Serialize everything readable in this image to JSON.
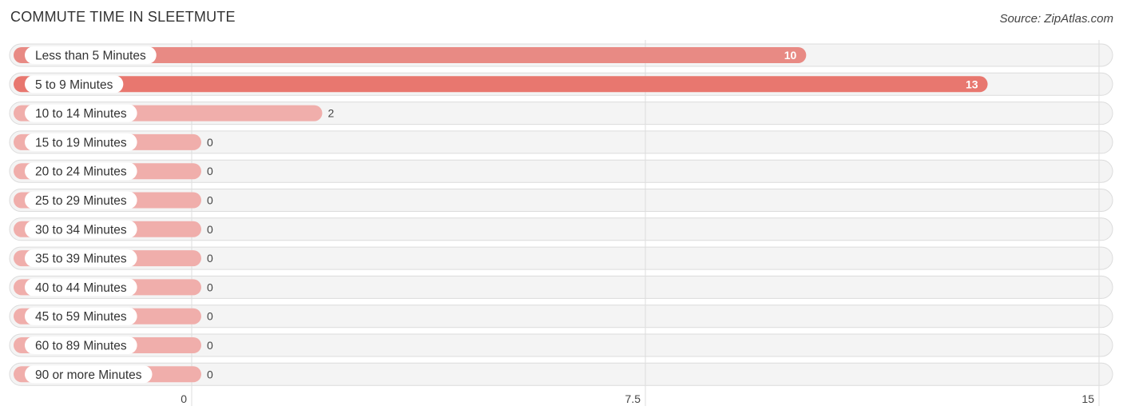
{
  "header": {
    "title": "COMMUTE TIME IN SLEETMUTE",
    "source": "Source: ZipAtlas.com"
  },
  "chart_data": {
    "type": "bar",
    "orientation": "horizontal",
    "title": "COMMUTE TIME IN SLEETMUTE",
    "xlabel": "",
    "ylabel": "",
    "categories": [
      "Less than 5 Minutes",
      "5 to 9 Minutes",
      "10 to 14 Minutes",
      "15 to 19 Minutes",
      "20 to 24 Minutes",
      "25 to 29 Minutes",
      "30 to 34 Minutes",
      "35 to 39 Minutes",
      "40 to 44 Minutes",
      "45 to 59 Minutes",
      "60 to 89 Minutes",
      "90 or more Minutes"
    ],
    "values": [
      10,
      13,
      2,
      0,
      0,
      0,
      0,
      0,
      0,
      0,
      0,
      0
    ],
    "value_labels": [
      "10",
      "13",
      "2",
      "0",
      "0",
      "0",
      "0",
      "0",
      "0",
      "0",
      "0",
      "0"
    ],
    "xlim": [
      0,
      15
    ],
    "ticks": [
      0,
      7.5,
      15
    ],
    "tick_labels": [
      "0",
      "7.5",
      "15"
    ],
    "grid": true,
    "colors": {
      "strong": "#e8776f",
      "medium": "#e88a84",
      "light": "#f0aeab"
    }
  }
}
